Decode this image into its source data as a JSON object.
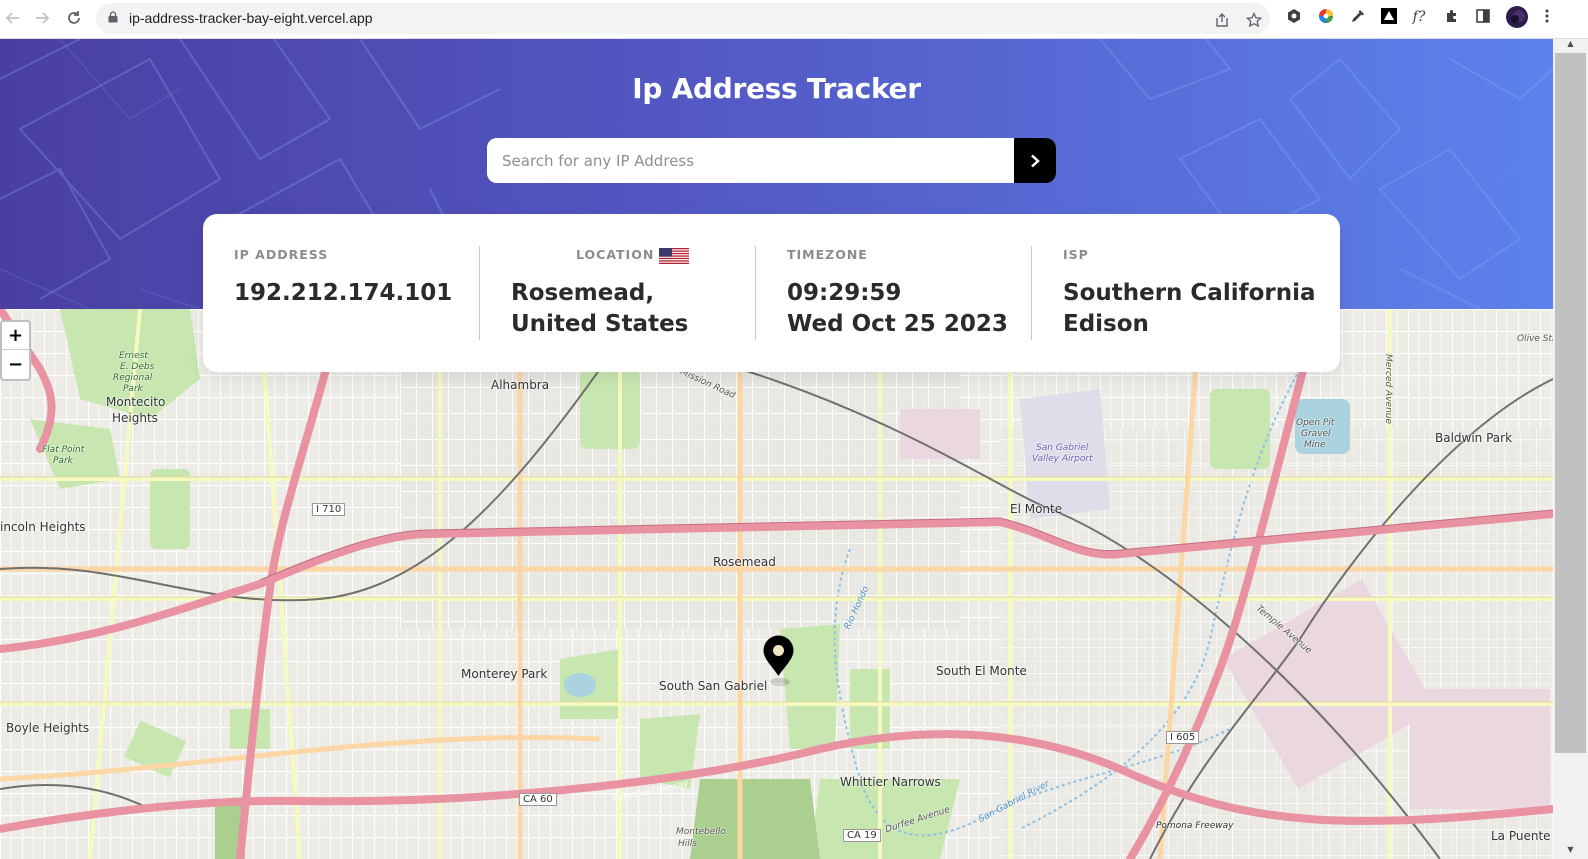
{
  "browser": {
    "url": "ip-address-tracker-bay-eight.vercel.app",
    "back_icon": "back-arrow-icon",
    "forward_icon": "forward-arrow-icon",
    "reload_icon": "reload-icon",
    "lock_icon": "lock-icon",
    "share_icon": "share-icon",
    "bookmark_icon": "star-icon",
    "extension_fx_label": "f?"
  },
  "app": {
    "title": "Ip Address Tracker",
    "search": {
      "placeholder": "Search for any IP Address",
      "value": ""
    },
    "submit_icon": "chevron-right-icon",
    "accent": "#000000"
  },
  "info": {
    "ip": {
      "label": "IP ADDRESS",
      "value": "192.212.174.101"
    },
    "location": {
      "label": "LOCATION",
      "value": "Rosemead, United States",
      "flag_icon": "us-flag-icon"
    },
    "timezone": {
      "label": "TIMEZONE",
      "time": "09:29:59",
      "date": "Wed Oct 25 2023"
    },
    "isp": {
      "label": "ISP",
      "value": "Southern California Edison"
    }
  },
  "map": {
    "zoom_in": "+",
    "zoom_out": "−",
    "labels": {
      "alhambra": "Alhambra",
      "rosemead": "Rosemead",
      "el_monte": "El Monte",
      "monterey_park": "Monterey Park",
      "south_san_gabriel": "South San Gabriel",
      "south_el_monte": "South El Monte",
      "baldwin_park": "Baldwin Park",
      "lincoln_heights": "incoln Heights",
      "boyle_heights": "Boyle Heights",
      "montecito": "Montecito",
      "montecito_heights": "Heights",
      "whittier_narrows": "Whittier Narrows",
      "la_puente": "La Puente",
      "montebello": "Montebello",
      "hills": "Hills",
      "ernest_debs": "Ernest",
      "ernest_debs2": "E. Debs",
      "ernest_debs3": "Regional",
      "ernest_debs4": "Park",
      "flat_point": "Flat Point",
      "flat_point2": "Park",
      "airport": "San Gabriel",
      "airport2": "Valley Airport",
      "gravel": "Open Pit",
      "gravel2": "Gravel",
      "gravel3": "Mine",
      "i710": "I 710",
      "i605": "I 605",
      "ca60": "CA 60",
      "ca19": "CA 19",
      "pomona_fwy": "Pomona Freeway",
      "pomona_fwy2": "Pomona Freeway",
      "mission_road": "Mission Road",
      "durfee": "Durfee Avenue",
      "temple": "Temple Avenue",
      "olive": "Olive Stre",
      "merced": "Merced Avenue",
      "rio_hondo": "Rio Hondo",
      "san_gabriel_river": "San Gabriel River"
    },
    "marker_icon": "location-pin-icon"
  }
}
